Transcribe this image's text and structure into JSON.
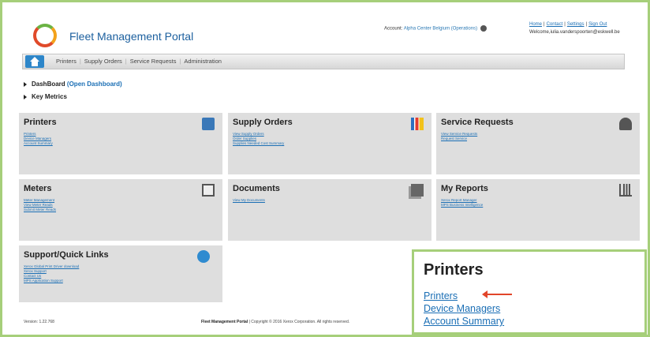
{
  "header": {
    "portal_title": "Fleet Management Portal",
    "account_label": "Account:",
    "account_name": "Alpha Center Belgium (Operations)",
    "links": [
      "Home",
      "Contact",
      "Settings",
      "Sign Out"
    ],
    "welcome": "Welcome,iulia.vanderspoorten@eskwell.be"
  },
  "nav": {
    "items": [
      "Printers",
      "Supply Orders",
      "Service Requests",
      "Administration"
    ]
  },
  "dashboard": {
    "label": "DashBoard",
    "link": "(Open Dashboard)",
    "key_metrics": "Key Metrics"
  },
  "tiles": {
    "printers": {
      "title": "Printers",
      "links": [
        "Printers",
        "Device Managers",
        "Account Summary"
      ]
    },
    "supply_orders": {
      "title": "Supply Orders",
      "links": [
        "View Supply Orders",
        "Order Supplies",
        "Supplies Needed Cost Summary"
      ]
    },
    "service_requests": {
      "title": "Service Requests",
      "links": [
        "View Service Requests",
        "Request Service"
      ]
    },
    "meters": {
      "title": "Meters",
      "links": [
        "Meter Management",
        "View Meter Reads",
        "Submit Meter Reads"
      ]
    },
    "documents": {
      "title": "Documents",
      "links": [
        "View My Documents"
      ]
    },
    "my_reports": {
      "title": "My Reports",
      "links": [
        "Xerox Report Manager",
        "MPS Business Intelligence"
      ]
    },
    "support": {
      "title": "Support/Quick Links",
      "links": [
        "Xerox Global Print Driver download",
        "Xerox Support",
        "Contact Us",
        "MPS Application Support"
      ]
    }
  },
  "footer": {
    "version": "Version: 1.22.768",
    "portal": "Fleet Management Portal",
    "copyright": "| Copyright © 2016 Xerox Corporation. All rights reserved."
  },
  "zoom": {
    "title": "Printers",
    "links": [
      "Printers",
      "Device Managers",
      "Account Summary"
    ]
  },
  "colors": {
    "frame": "#a6cf7a",
    "link": "#1b6fb5",
    "title": "#1b5f9e",
    "arrow": "#e2452a",
    "tile_bg": "#dedede"
  }
}
